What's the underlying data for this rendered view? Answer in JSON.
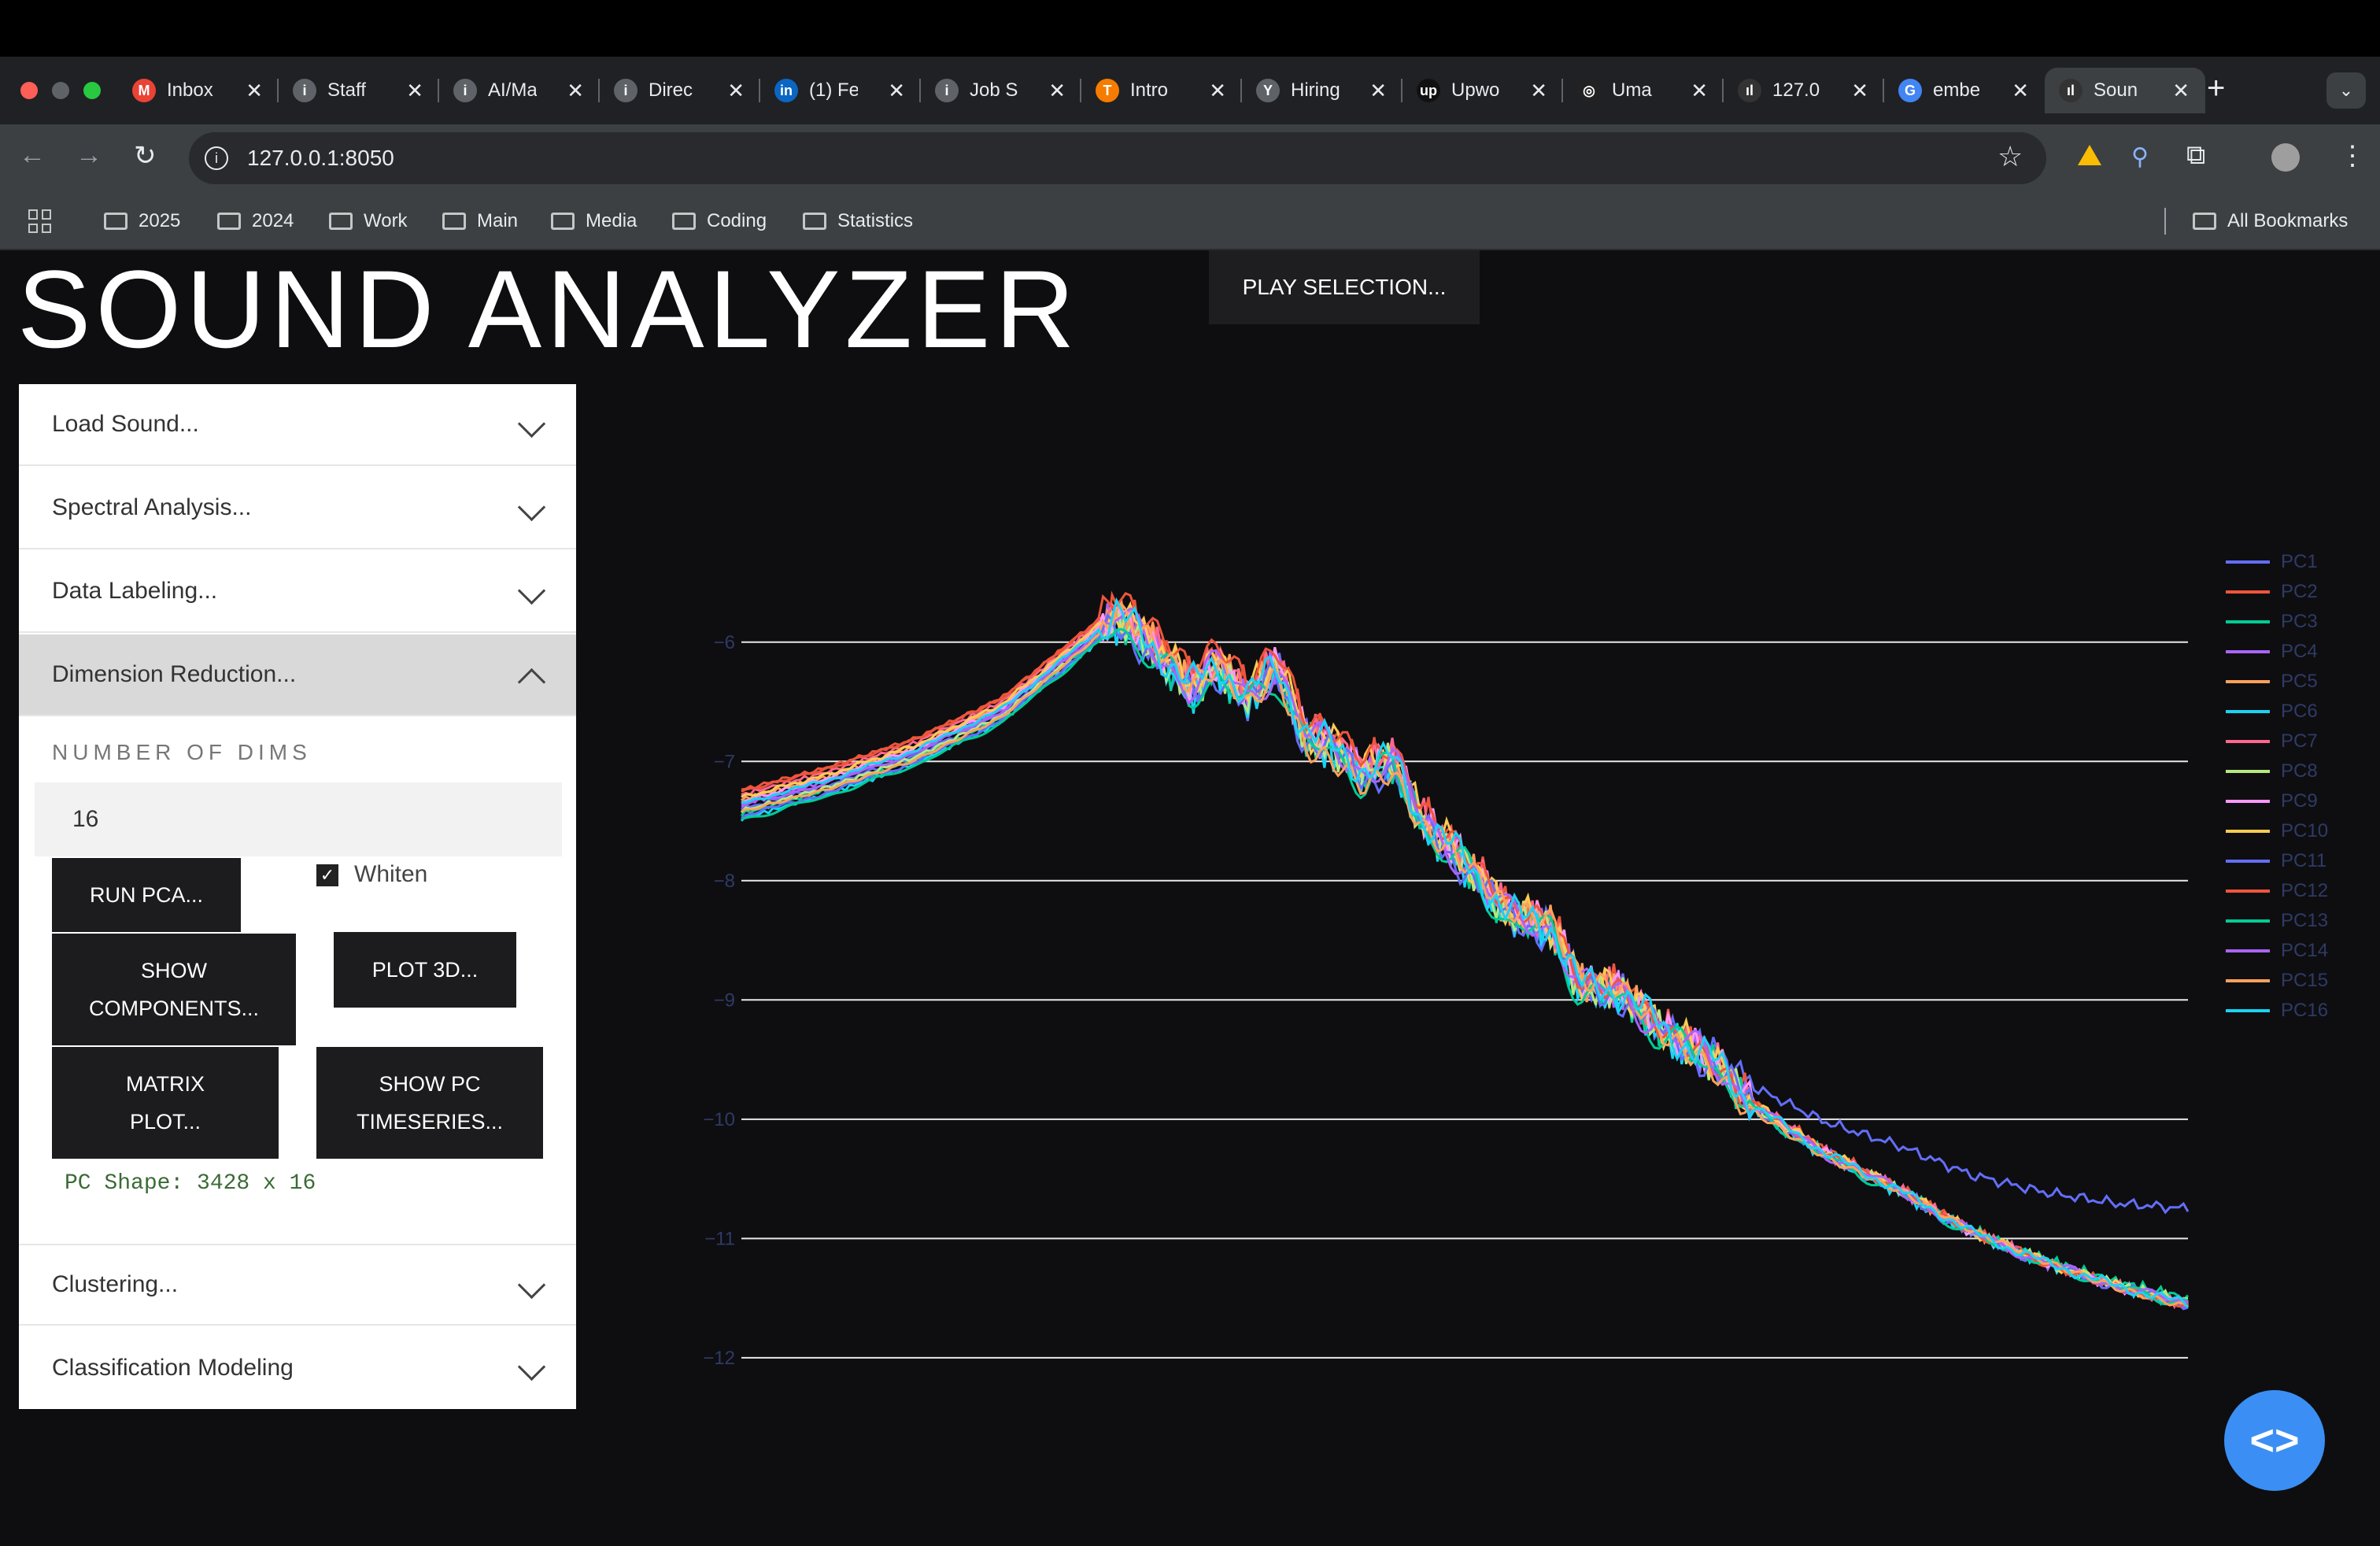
{
  "browser": {
    "tabs": [
      {
        "title": "Inbox",
        "fav": "M",
        "color": "#ea4335"
      },
      {
        "title": "Staff",
        "fav": "i",
        "color": "#5f6368"
      },
      {
        "title": "AI/Ma",
        "fav": "i",
        "color": "#5f6368"
      },
      {
        "title": "Direc",
        "fav": "i",
        "color": "#5f6368"
      },
      {
        "title": "(1) Fe",
        "fav": "in",
        "color": "#0a66c2"
      },
      {
        "title": "Job S",
        "fav": "i",
        "color": "#5f6368"
      },
      {
        "title": "Intro",
        "fav": "T",
        "color": "#f57c00"
      },
      {
        "title": "Hiring",
        "fav": "Y",
        "color": "#5f6368"
      },
      {
        "title": "Upwo",
        "fav": "up",
        "color": "#111111"
      },
      {
        "title": "Uma",
        "fav": "◎",
        "color": "#222222"
      },
      {
        "title": "127.0",
        "fav": "ıl",
        "color": "#333333"
      },
      {
        "title": "embe",
        "fav": "G",
        "color": "#4285f4"
      },
      {
        "title": "Soun",
        "fav": "ıl",
        "color": "#333333"
      }
    ],
    "new_tab": "+",
    "url": "127.0.0.1:8050",
    "bookmarks": [
      "2025",
      "2024",
      "Work",
      "Main",
      "Media",
      "Coding",
      "Statistics"
    ],
    "all_bookmarks": "All Bookmarks"
  },
  "app": {
    "title": "SOUND ANALYZER",
    "play_selection": "PLAY SELECTION...",
    "sections": {
      "load": "Load Sound...",
      "spectral": "Spectral Analysis...",
      "labeling": "Data Labeling...",
      "dimred": "Dimension Reduction...",
      "clustering": "Clustering...",
      "classification": "Classification Modeling"
    },
    "dimred": {
      "num_dims_label": "NUMBER OF DIMS",
      "num_dims_value": "16",
      "run_pca": "RUN PCA...",
      "whiten_label": "Whiten",
      "whiten_checked": true,
      "show_components": "SHOW COMPONENTS...",
      "plot_3d": "PLOT 3D...",
      "matrix_plot": "MATRIX PLOT...",
      "show_pc_timeseries": "SHOW PC TIMESERIES...",
      "pc_shape": "PC Shape: 3428 x 16"
    },
    "fab_icon": "code-icon"
  },
  "chart_data": {
    "type": "line",
    "title": "",
    "xlabel": "",
    "ylabel": "",
    "ylim": [
      -12.1,
      -5.5
    ],
    "yticks": [
      "−6",
      "−7",
      "−8",
      "−9",
      "−10",
      "−11",
      "−12"
    ],
    "ytick_values": [
      -6,
      -7,
      -8,
      -9,
      -10,
      -11,
      -12
    ],
    "grid": true,
    "legend_position": "right",
    "x_range": [
      0,
      1
    ],
    "base_curve": [
      [
        0,
        -7.4
      ],
      [
        0.06,
        -7.2
      ],
      [
        0.12,
        -6.95
      ],
      [
        0.18,
        -6.6
      ],
      [
        0.22,
        -6.2
      ],
      [
        0.26,
        -5.8
      ],
      [
        0.28,
        -6.0
      ],
      [
        0.31,
        -6.4
      ],
      [
        0.33,
        -6.2
      ],
      [
        0.35,
        -6.5
      ],
      [
        0.37,
        -6.2
      ],
      [
        0.39,
        -6.8
      ],
      [
        0.41,
        -6.9
      ],
      [
        0.43,
        -7.1
      ],
      [
        0.45,
        -7.0
      ],
      [
        0.47,
        -7.5
      ],
      [
        0.5,
        -7.85
      ],
      [
        0.53,
        -8.3
      ],
      [
        0.56,
        -8.4
      ],
      [
        0.58,
        -8.9
      ],
      [
        0.61,
        -8.95
      ],
      [
        0.64,
        -9.3
      ],
      [
        0.67,
        -9.5
      ],
      [
        0.7,
        -9.9
      ],
      [
        0.75,
        -10.3
      ],
      [
        0.8,
        -10.6
      ],
      [
        0.85,
        -10.95
      ],
      [
        0.9,
        -11.2
      ],
      [
        0.95,
        -11.4
      ],
      [
        1.0,
        -11.55
      ]
    ],
    "series": [
      {
        "name": "PC1",
        "color": "#636efa",
        "offset": 0.0,
        "tail": 0.8
      },
      {
        "name": "PC2",
        "color": "#ef553b",
        "offset": 0.2,
        "tail": 0.0
      },
      {
        "name": "PC3",
        "color": "#00cc96",
        "offset": -0.05,
        "tail": 0.05
      },
      {
        "name": "PC4",
        "color": "#ab63fa",
        "offset": 0.05,
        "tail": 0.0
      },
      {
        "name": "PC5",
        "color": "#ffa15a",
        "offset": 0.1,
        "tail": 0.0
      },
      {
        "name": "PC6",
        "color": "#19d3f3",
        "offset": -0.1,
        "tail": 0.0
      },
      {
        "name": "PC7",
        "color": "#ff6692",
        "offset": 0.15,
        "tail": 0.0
      },
      {
        "name": "PC8",
        "color": "#b6e880",
        "offset": -0.02,
        "tail": 0.02
      },
      {
        "name": "PC9",
        "color": "#ff97ff",
        "offset": 0.08,
        "tail": 0.0
      },
      {
        "name": "PC10",
        "color": "#fecb52",
        "offset": 0.12,
        "tail": 0.0
      },
      {
        "name": "PC11",
        "color": "#636efa",
        "offset": -0.08,
        "tail": 0.0
      },
      {
        "name": "PC12",
        "color": "#ef553b",
        "offset": 0.18,
        "tail": 0.0
      },
      {
        "name": "PC13",
        "color": "#00cc96",
        "offset": -0.12,
        "tail": 0.0
      },
      {
        "name": "PC14",
        "color": "#ab63fa",
        "offset": 0.03,
        "tail": 0.0
      },
      {
        "name": "PC15",
        "color": "#ffa15a",
        "offset": -0.04,
        "tail": 0.0
      },
      {
        "name": "PC16",
        "color": "#19d3f3",
        "offset": 0.06,
        "tail": 0.0
      }
    ]
  }
}
